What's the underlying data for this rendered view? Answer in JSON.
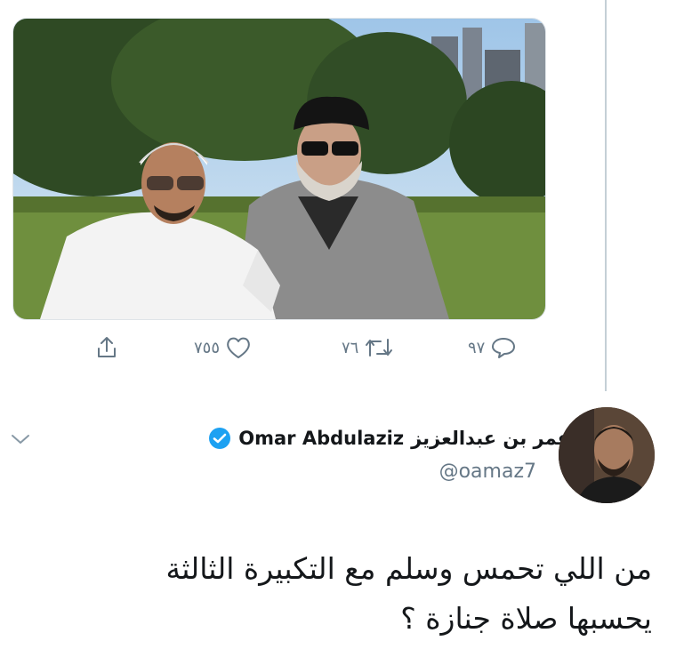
{
  "tweet_actions": {
    "reply_count": "٩٧",
    "retweet_count": "٧٦",
    "like_count": "٧٥٥"
  },
  "author": {
    "name_arabic": "عمر بن عبدالعزيز",
    "name_english": "Omar Abdulaziz",
    "handle": "@oamaz7"
  },
  "tweet": {
    "line1": "من اللي تحمس وسلم مع التكبيرة الثالثة",
    "line2": "يحسبها صلاة جنازة ؟"
  },
  "colors": {
    "verified": "#1da1f2",
    "muted": "#657786",
    "text": "#14171a"
  }
}
